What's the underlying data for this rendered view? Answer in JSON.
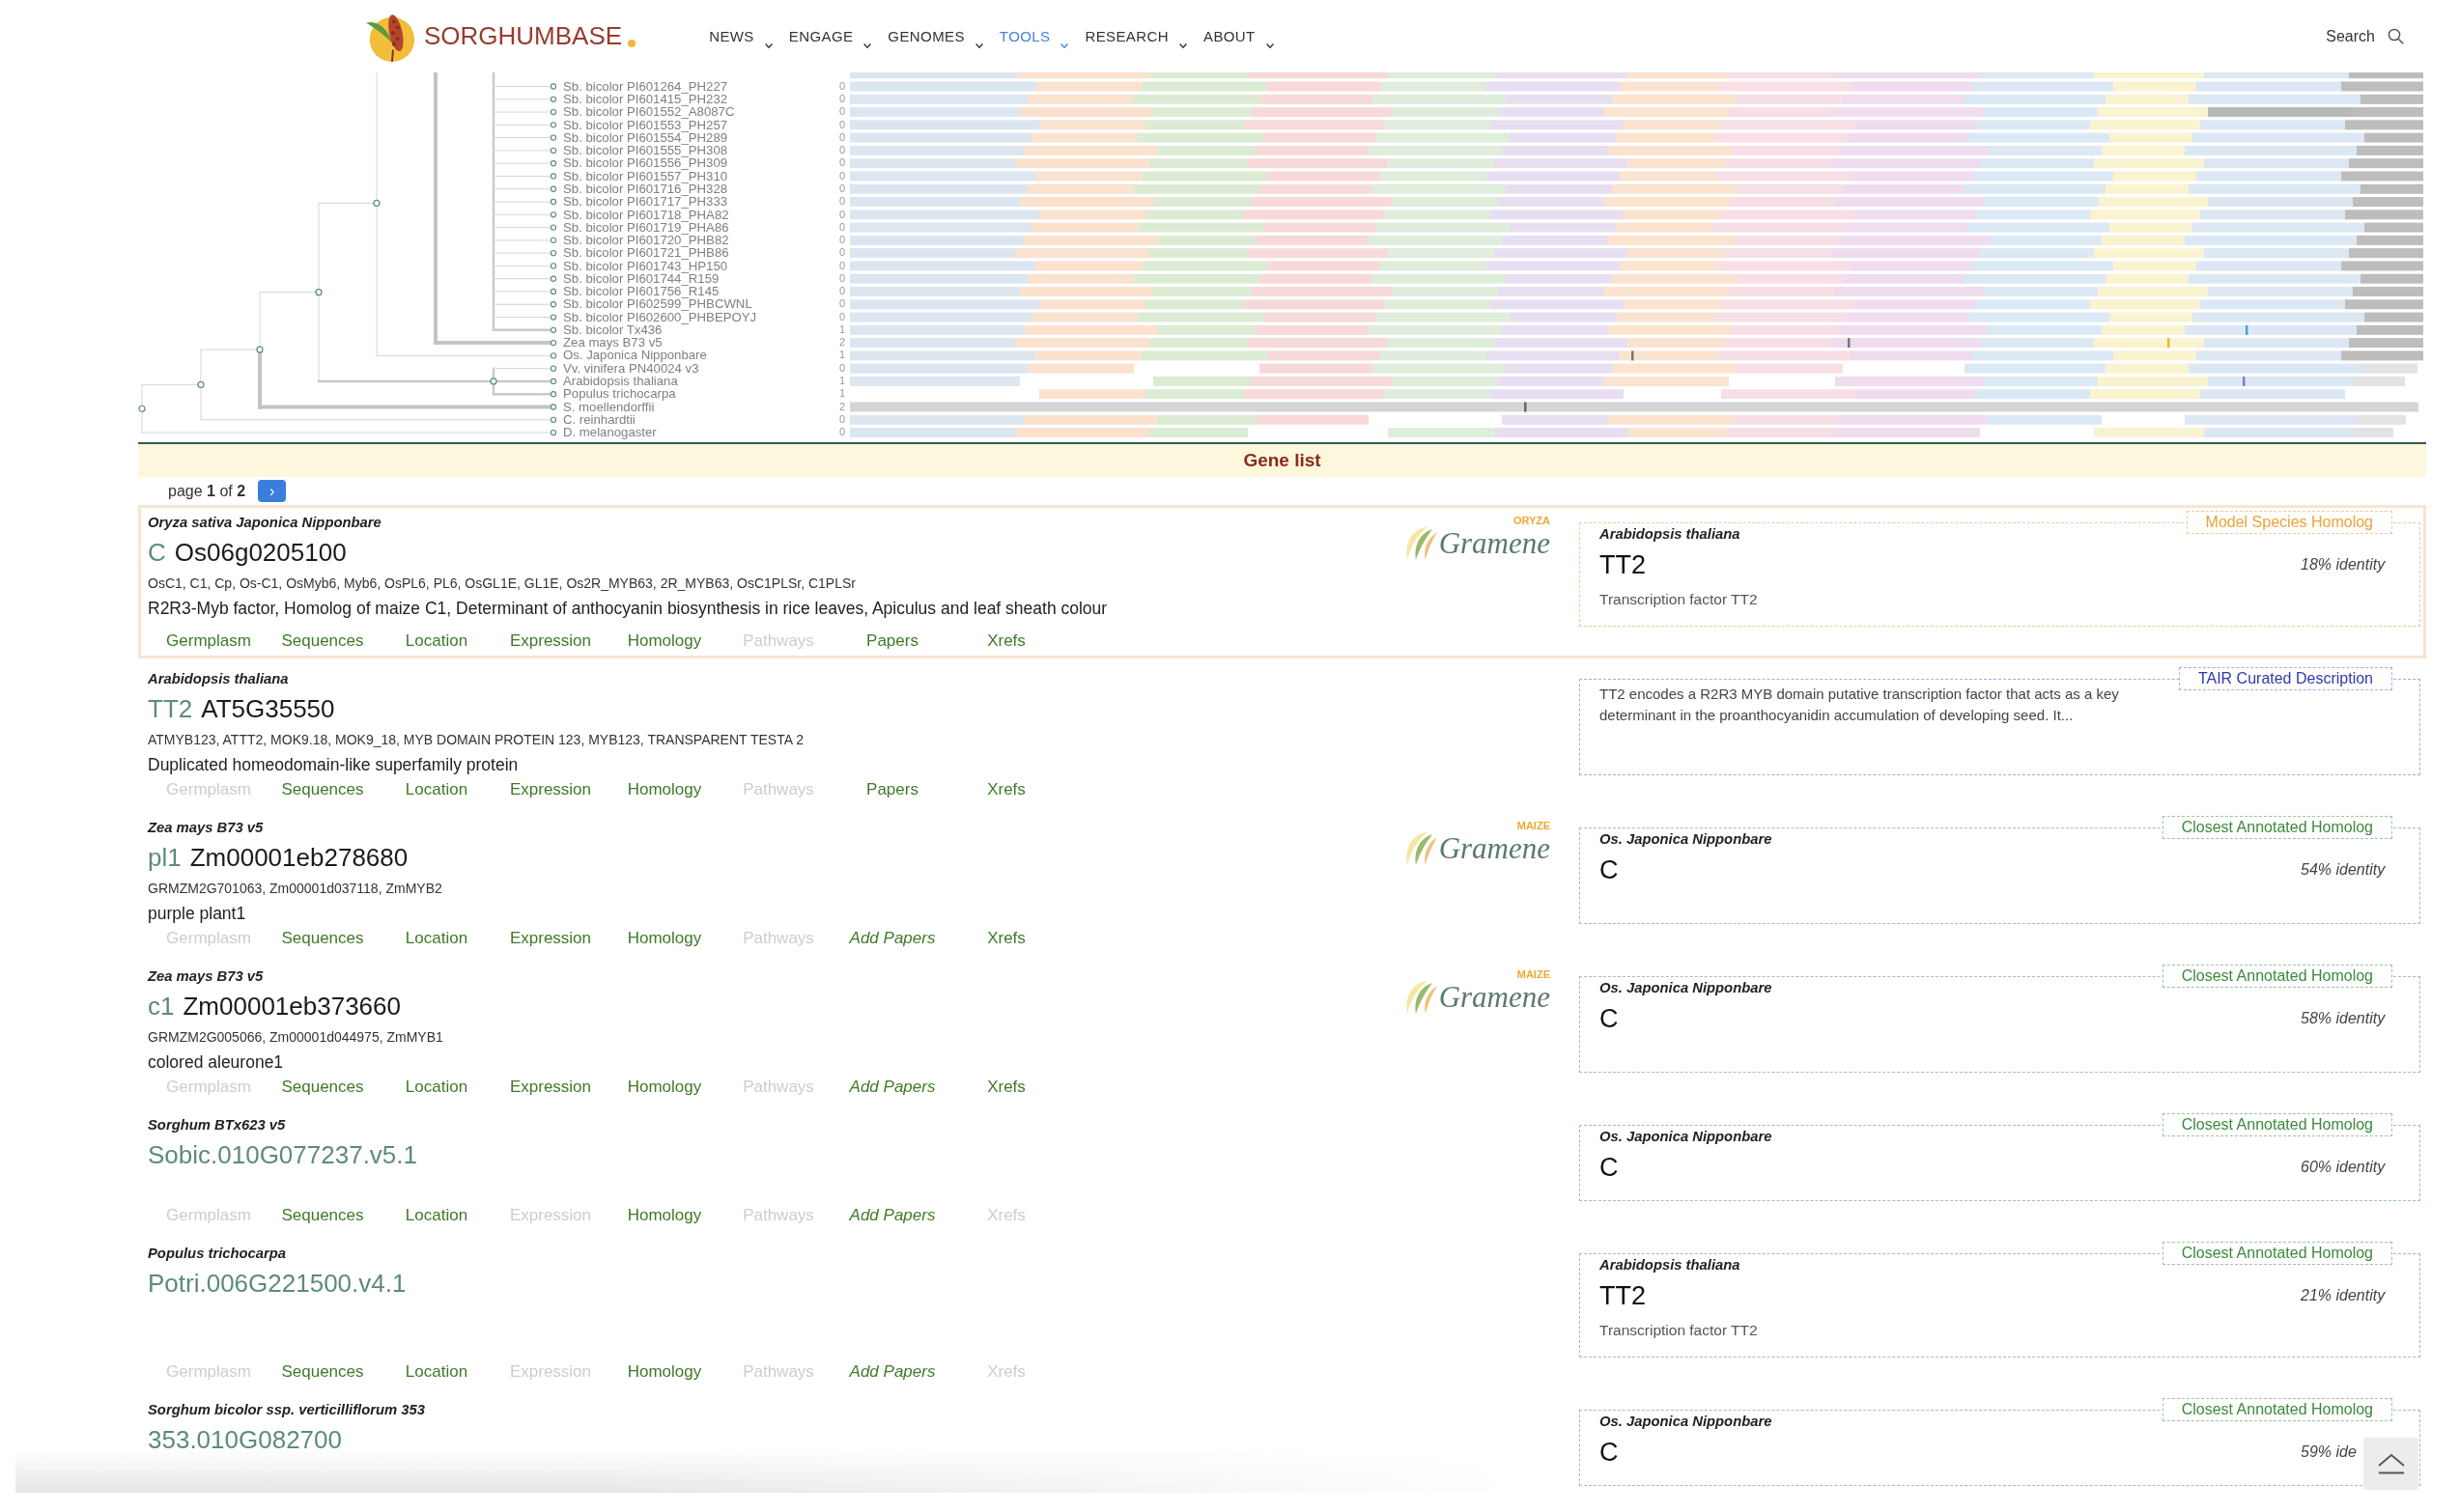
{
  "header": {
    "logo": {
      "text": "SORGHUMBASE"
    },
    "nav": [
      {
        "label": "NEWS",
        "selected": false
      },
      {
        "label": "ENGAGE",
        "selected": false
      },
      {
        "label": "GENOMES",
        "selected": false
      },
      {
        "label": "TOOLS",
        "selected": true
      },
      {
        "label": "RESEARCH",
        "selected": false
      },
      {
        "label": "ABOUT",
        "selected": false
      }
    ],
    "search": {
      "label": "Search"
    }
  },
  "tree": {
    "leaves": [
      {
        "label": "Sb. bicolor PI601264_PH227",
        "count": "0"
      },
      {
        "label": "Sb. bicolor PI601415_PH232",
        "count": "0"
      },
      {
        "label": "Sb. bicolor PI601552_A8087C",
        "count": "0"
      },
      {
        "label": "Sb. bicolor PI601553_PH257",
        "count": "0"
      },
      {
        "label": "Sb. bicolor PI601554_PH289",
        "count": "0"
      },
      {
        "label": "Sb. bicolor PI601555_PH308",
        "count": "0"
      },
      {
        "label": "Sb. bicolor PI601556_PH309",
        "count": "0"
      },
      {
        "label": "Sb. bicolor PI601557_PH310",
        "count": "0"
      },
      {
        "label": "Sb. bicolor PI601716_PH328",
        "count": "0"
      },
      {
        "label": "Sb. bicolor PI601717_PH333",
        "count": "0"
      },
      {
        "label": "Sb. bicolor PI601718_PHA82",
        "count": "0"
      },
      {
        "label": "Sb. bicolor PI601719_PHA86",
        "count": "0"
      },
      {
        "label": "Sb. bicolor PI601720_PHB82",
        "count": "0"
      },
      {
        "label": "Sb. bicolor PI601721_PHB86",
        "count": "0"
      },
      {
        "label": "Sb. bicolor PI601743_HP150",
        "count": "0"
      },
      {
        "label": "Sb. bicolor PI601744_R159",
        "count": "0"
      },
      {
        "label": "Sb. bicolor PI601756_R145",
        "count": "0"
      },
      {
        "label": "Sb. bicolor PI602599_PHBCWNL",
        "count": "0"
      },
      {
        "label": "Sb. bicolor PI602600_PHBEPOYJ",
        "count": "0"
      },
      {
        "label": "Sb. bicolor Tx436",
        "count": "1"
      },
      {
        "label": "Zea mays B73 v5",
        "count": "2"
      },
      {
        "label": "Os. Japonica Nipponbare",
        "count": "1"
      },
      {
        "label": "Vv. vinifera PN40024 v3",
        "count": "0"
      },
      {
        "label": "Arabidopsis thaliana",
        "count": "1"
      },
      {
        "label": "Populus trichocarpa",
        "count": "1"
      },
      {
        "label": "S. moellendorffii",
        "count": "2"
      },
      {
        "label": "C. reinhardtii",
        "count": "0"
      },
      {
        "label": "D. melanogaster",
        "count": "0"
      }
    ]
  },
  "gene_list": {
    "title": "Gene list",
    "pager": {
      "text": "page **1** of **2**",
      "next": "›"
    },
    "genes": [
      {
        "selected": true,
        "species": "Oryza sativa Japonica Nipponbare",
        "symbol": "C",
        "id": "Os06g0205100",
        "synonyms": "OsC1, C1, Cp, Os-C1, OsMyb6, Myb6, OsPL6, PL6, OsGL1E, GL1E, Os2R_MYB63, 2R_MYB63, OsC1PLSr, C1PLSr",
        "description": "R2R3-Myb factor, Homolog of maize C1, Determinant of anthocyanin biosynthesis in rice leaves, Apiculus and leaf sheath colour",
        "logo": {
          "name": "Gramene",
          "tag": "ORYZA"
        },
        "homolog": {
          "kind": "model",
          "badge": "Model Species Homolog",
          "species": "Arabidopsis thaliana",
          "symbol": "TT2",
          "identity": "18% identity",
          "description": "Transcription factor TT2"
        },
        "links": [
          {
            "label": "Germplasm",
            "kind": "link",
            "disabled": false
          },
          {
            "label": "Sequences",
            "kind": "link",
            "disabled": false
          },
          {
            "label": "Location",
            "kind": "link",
            "disabled": false
          },
          {
            "label": "Expression",
            "kind": "link",
            "disabled": false
          },
          {
            "label": "Homology",
            "kind": "link",
            "disabled": false
          },
          {
            "label": "Pathways",
            "kind": "link",
            "disabled": true
          },
          {
            "label": "Papers",
            "kind": "link",
            "disabled": false
          },
          {
            "label": "Xrefs",
            "kind": "link",
            "disabled": false
          }
        ]
      },
      {
        "selected": false,
        "species": "Arabidopsis thaliana",
        "symbol": "TT2",
        "id": "AT5G35550",
        "synonyms": "ATMYB123, ATTT2, MOK9.18, MOK9_18, MYB DOMAIN PROTEIN 123, MYB123, TRANSPARENT TESTA 2",
        "description": "Duplicated homeodomain-like superfamily protein",
        "homolog": {
          "kind": "tair",
          "badge": "TAIR Curated Description",
          "text": "TT2 encodes a R2R3 MYB domain putative transcription factor that acts as a key determinant in the proanthocyanidin accumulation of developing seed. It..."
        },
        "links": [
          {
            "label": "Germplasm",
            "kind": "link",
            "disabled": true
          },
          {
            "label": "Sequences",
            "kind": "link",
            "disabled": false
          },
          {
            "label": "Location",
            "kind": "link",
            "disabled": false
          },
          {
            "label": "Expression",
            "kind": "link",
            "disabled": false
          },
          {
            "label": "Homology",
            "kind": "link",
            "disabled": false
          },
          {
            "label": "Pathways",
            "kind": "link",
            "disabled": true
          },
          {
            "label": "Papers",
            "kind": "link",
            "disabled": false
          },
          {
            "label": "Xrefs",
            "kind": "link",
            "disabled": false
          }
        ]
      },
      {
        "selected": false,
        "species": "Zea mays B73 v5",
        "symbol": "pl1",
        "id": "Zm00001eb278680",
        "synonyms": "GRMZM2G701063, Zm00001d037118, ZmMYB2",
        "description": "purple plant1",
        "logo": {
          "name": "Gramene",
          "tag": "MAIZE"
        },
        "homolog": {
          "kind": "closest",
          "badge": "Closest Annotated Homolog",
          "species": "Os. Japonica Nipponbare",
          "symbol": "C",
          "identity": "54% identity"
        },
        "links": [
          {
            "label": "Germplasm",
            "kind": "link",
            "disabled": true
          },
          {
            "label": "Sequences",
            "kind": "link",
            "disabled": false
          },
          {
            "label": "Location",
            "kind": "link",
            "disabled": false
          },
          {
            "label": "Expression",
            "kind": "link",
            "disabled": false
          },
          {
            "label": "Homology",
            "kind": "link",
            "disabled": false
          },
          {
            "label": "Pathways",
            "kind": "link",
            "disabled": true
          },
          {
            "label": "Add Papers",
            "kind": "add",
            "disabled": false
          },
          {
            "label": "Xrefs",
            "kind": "link",
            "disabled": false
          }
        ]
      },
      {
        "selected": false,
        "species": "Zea mays B73 v5",
        "symbol": "c1",
        "id": "Zm00001eb373660",
        "synonyms": "GRMZM2G005066, Zm00001d044975, ZmMYB1",
        "description": "colored aleurone1",
        "logo": {
          "name": "Gramene",
          "tag": "MAIZE"
        },
        "homolog": {
          "kind": "closest",
          "badge": "Closest Annotated Homolog",
          "species": "Os. Japonica Nipponbare",
          "symbol": "C",
          "identity": "58% identity"
        },
        "links": [
          {
            "label": "Germplasm",
            "kind": "link",
            "disabled": true
          },
          {
            "label": "Sequences",
            "kind": "link",
            "disabled": false
          },
          {
            "label": "Location",
            "kind": "link",
            "disabled": false
          },
          {
            "label": "Expression",
            "kind": "link",
            "disabled": false
          },
          {
            "label": "Homology",
            "kind": "link",
            "disabled": false
          },
          {
            "label": "Pathways",
            "kind": "link",
            "disabled": true
          },
          {
            "label": "Add Papers",
            "kind": "add",
            "disabled": false
          },
          {
            "label": "Xrefs",
            "kind": "link",
            "disabled": false
          }
        ]
      },
      {
        "selected": false,
        "species": "Sorghum BTx623 v5",
        "id": "Sobic.010G077237.v5.1",
        "homolog": {
          "kind": "closest",
          "badge": "Closest Annotated Homolog",
          "species": "Os. Japonica Nipponbare",
          "symbol": "C",
          "identity": "60% identity"
        },
        "links": [
          {
            "label": "Germplasm",
            "kind": "link",
            "disabled": true
          },
          {
            "label": "Sequences",
            "kind": "link",
            "disabled": false
          },
          {
            "label": "Location",
            "kind": "link",
            "disabled": false
          },
          {
            "label": "Expression",
            "kind": "link",
            "disabled": true
          },
          {
            "label": "Homology",
            "kind": "link",
            "disabled": false
          },
          {
            "label": "Pathways",
            "kind": "link",
            "disabled": true
          },
          {
            "label": "Add Papers",
            "kind": "add",
            "disabled": false
          },
          {
            "label": "Xrefs",
            "kind": "link",
            "disabled": true
          }
        ]
      },
      {
        "selected": false,
        "species": "Populus trichocarpa",
        "id": "Potri.006G221500.v4.1",
        "homolog": {
          "kind": "closest",
          "badge": "Closest Annotated Homolog",
          "species": "Arabidopsis thaliana",
          "symbol": "TT2",
          "identity": "21% identity",
          "description": "Transcription factor TT2"
        },
        "links": [
          {
            "label": "Germplasm",
            "kind": "link",
            "disabled": true
          },
          {
            "label": "Sequences",
            "kind": "link",
            "disabled": false
          },
          {
            "label": "Location",
            "kind": "link",
            "disabled": false
          },
          {
            "label": "Expression",
            "kind": "link",
            "disabled": true
          },
          {
            "label": "Homology",
            "kind": "link",
            "disabled": false
          },
          {
            "label": "Pathways",
            "kind": "link",
            "disabled": true
          },
          {
            "label": "Add Papers",
            "kind": "add",
            "disabled": false
          },
          {
            "label": "Xrefs",
            "kind": "link",
            "disabled": true
          }
        ]
      },
      {
        "selected": false,
        "species": "Sorghum bicolor ssp. verticilliflorum 353",
        "id": "353.010G082700",
        "homolog": {
          "kind": "closest",
          "badge": "Closest Annotated Homolog",
          "species": "Os. Japonica Nipponbare",
          "symbol": "C",
          "identity": "59% ide"
        }
      }
    ]
  }
}
